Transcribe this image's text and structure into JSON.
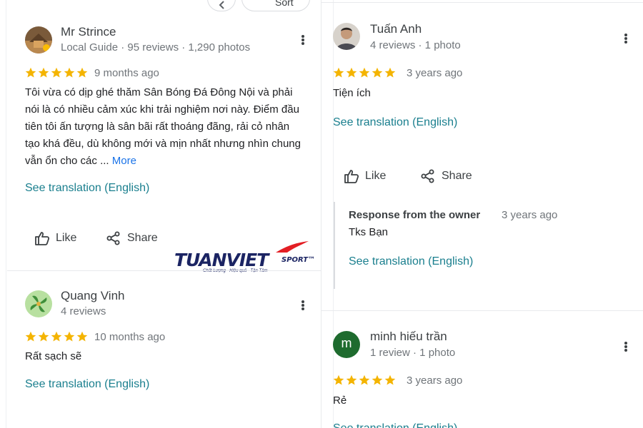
{
  "top_chips": [
    {
      "label": "",
      "icon": "chevron-left-icon"
    },
    {
      "label": "Sort",
      "icon": "sort-icon"
    }
  ],
  "reviews": [
    {
      "name": "Mr Strince",
      "meta": "Local Guide · 95 reviews · 1,290 photos",
      "rating": 5,
      "time": "9 months ago",
      "text": "Tôi vừa có dịp ghé thăm Sân Bóng Đá Đông Nội và phải nói là có nhiều cảm xúc khi trải nghiệm nơi này. Điểm đầu tiên tôi ấn tượng là sân bãi rất thoáng đãng, rải cỏ nhân tạo khá đều, dù không mới và mịn nhất nhưng nhìn chung vẫn ổn cho các ...",
      "more_label": "More",
      "translate_label": "See translation (English)",
      "like_label": "Like",
      "share_label": "Share"
    },
    {
      "name": "Quang Vinh",
      "meta": "4 reviews",
      "rating": 5,
      "time": "10 months ago",
      "text": "Rất sạch sẽ",
      "translate_label": "See translation (English)"
    },
    {
      "name": "Tuấn Anh",
      "meta": "4 reviews · 1 photo",
      "rating": 5,
      "time": "3 years ago",
      "text": "Tiện ích",
      "translate_label": "See translation (English)",
      "like_label": "Like",
      "share_label": "Share",
      "owner_response": {
        "title": "Response from the owner",
        "time": "3 years ago",
        "text": "Tks Bạn",
        "translate_label": "See translation (English)"
      }
    },
    {
      "name": "minh hiếu trần",
      "avatar_letter": "m",
      "meta": "1 review · 1 photo",
      "rating": 5,
      "time": "3 years ago",
      "text": "Rẻ",
      "translate_label": "See translation (English)"
    }
  ],
  "watermark": {
    "brand": "TUANVIET",
    "brand_suffix": "SPORT™",
    "tagline": "Chất Lượng - Hiệu quả - Tận Tâm"
  },
  "colors": {
    "star": "#f4b400",
    "link": "#1a7f8e",
    "avatar_m": "#1e6b2e",
    "brand_navy": "#1b2463",
    "brand_red": "#e31e24"
  }
}
